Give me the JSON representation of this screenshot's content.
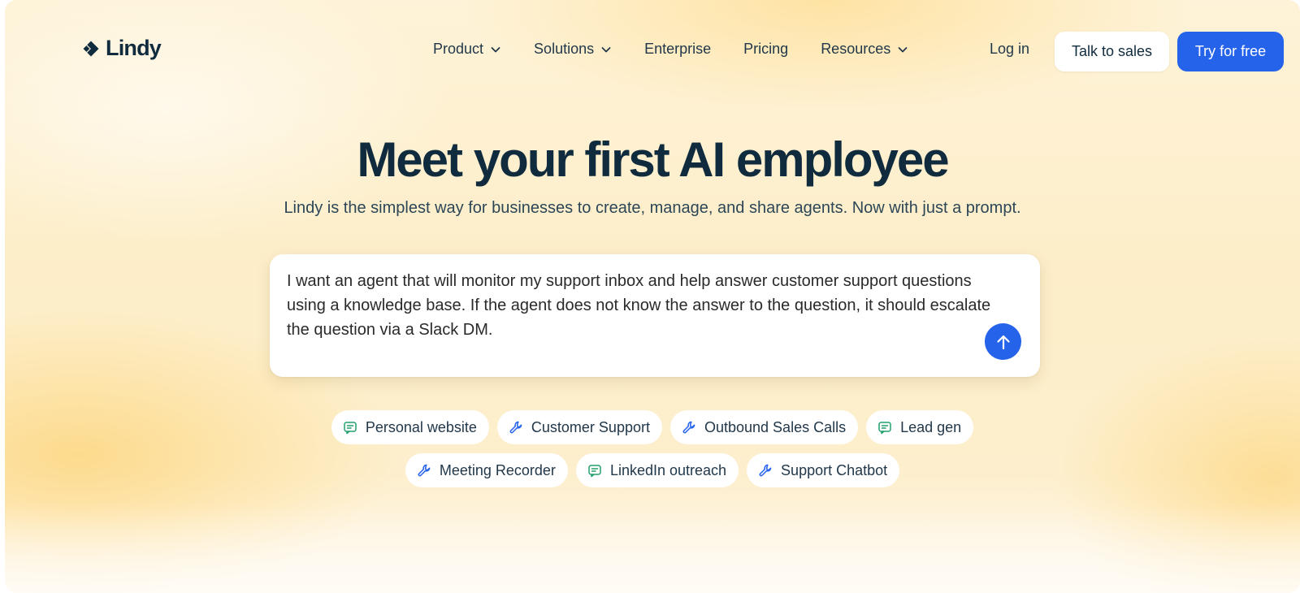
{
  "brand": {
    "name": "Lindy",
    "accent": "#2563eb",
    "text": "#0f2b3d"
  },
  "nav": {
    "items": [
      {
        "label": "Product",
        "dropdown": true
      },
      {
        "label": "Solutions",
        "dropdown": true
      },
      {
        "label": "Enterprise",
        "dropdown": false
      },
      {
        "label": "Pricing",
        "dropdown": false
      },
      {
        "label": "Resources",
        "dropdown": true
      }
    ],
    "login": "Log in",
    "talk_to_sales": "Talk to sales",
    "try_free": "Try for free"
  },
  "hero": {
    "title": "Meet your first AI employee",
    "subtitle": "Lindy is the simplest way for businesses to create, manage, and share agents. Now with just a prompt."
  },
  "prompt": {
    "text": "I want an agent that will monitor my support inbox and help answer customer support questions using a knowledge base. If the agent does not know the answer to the question, it should escalate the question via a Slack DM.",
    "send_icon": "arrow-up-icon"
  },
  "suggestions": {
    "row1": [
      {
        "label": "Personal website",
        "icon": "message-icon"
      },
      {
        "label": "Customer Support",
        "icon": "wrench-icon"
      },
      {
        "label": "Outbound Sales Calls",
        "icon": "wrench-icon"
      },
      {
        "label": "Lead gen",
        "icon": "message-icon"
      }
    ],
    "row2": [
      {
        "label": "Meeting Recorder",
        "icon": "wrench-icon"
      },
      {
        "label": "LinkedIn outreach",
        "icon": "message-icon"
      },
      {
        "label": "Support Chatbot",
        "icon": "wrench-icon"
      }
    ],
    "icon_colors": {
      "message-icon": "#22a06b",
      "wrench-icon": "#2563eb"
    }
  }
}
